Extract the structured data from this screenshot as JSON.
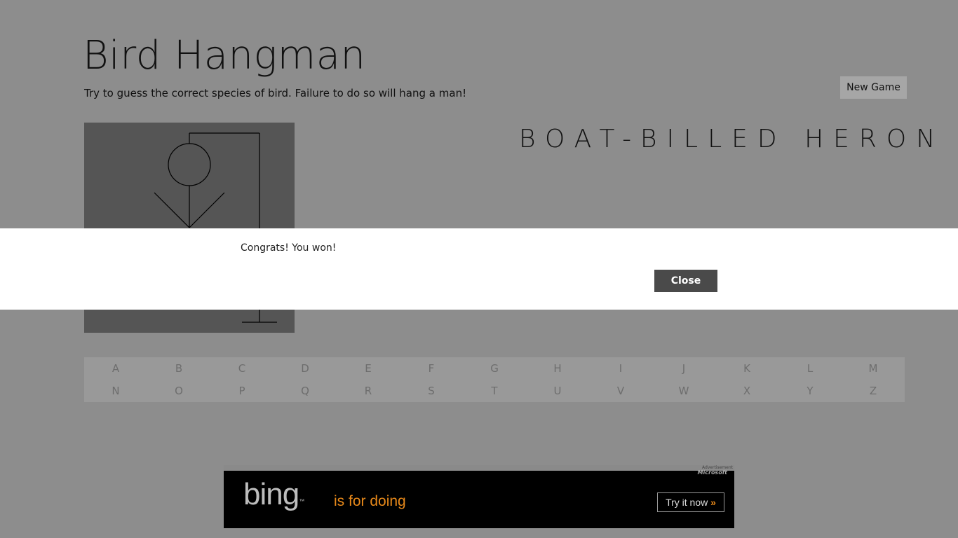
{
  "app": {
    "title": "Bird Hangman",
    "subtitle": "Try to guess the correct species of bird. Failure to do so will hang a man!",
    "new_game_label": "New Game",
    "word": "BOAT-BILLED HERON"
  },
  "keyboard": {
    "row1": [
      "A",
      "B",
      "C",
      "D",
      "E",
      "F",
      "G",
      "H",
      "I",
      "J",
      "K",
      "L",
      "M"
    ],
    "row2": [
      "N",
      "O",
      "P",
      "Q",
      "R",
      "S",
      "T",
      "U",
      "V",
      "W",
      "X",
      "Y",
      "Z"
    ]
  },
  "dialog": {
    "message": "Congrats!  You won!",
    "close_label": "Close"
  },
  "ad": {
    "label": "Advertisement",
    "brand": "Microsoft",
    "logo_text": "bing",
    "tm": "™",
    "tagline": "is for doing",
    "cta": "Try it now",
    "cta_chevron": "»"
  },
  "colors": {
    "background": "#8d8d8d",
    "gallows_bg": "#555555",
    "dialog_bg": "#ffffff",
    "close_button_bg": "#4a4a4a",
    "ad_accent": "#e8891a"
  }
}
